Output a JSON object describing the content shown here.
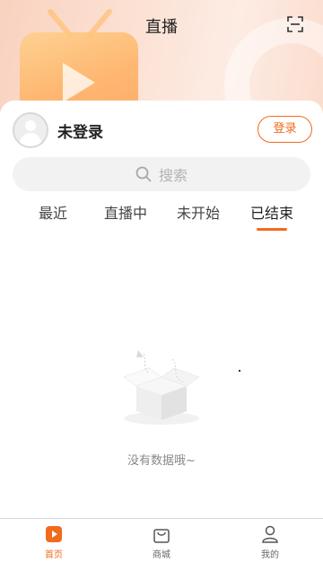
{
  "header": {
    "title": "直播",
    "scan_icon": "scan-icon",
    "accent": "#f26a1b"
  },
  "user": {
    "name": "未登录",
    "login_label": "登录"
  },
  "search": {
    "placeholder": "搜索"
  },
  "tabs": [
    {
      "label": "最近"
    },
    {
      "label": "直播中"
    },
    {
      "label": "未开始"
    },
    {
      "label": "已结束"
    }
  ],
  "active_tab": "已结束",
  "empty_state": {
    "message": "没有数据哦~"
  },
  "bottom_nav": [
    {
      "label": "首页",
      "icon": "home-play-icon"
    },
    {
      "label": "商城",
      "icon": "shopping-bag-icon"
    },
    {
      "label": "我的",
      "icon": "person-icon"
    }
  ]
}
